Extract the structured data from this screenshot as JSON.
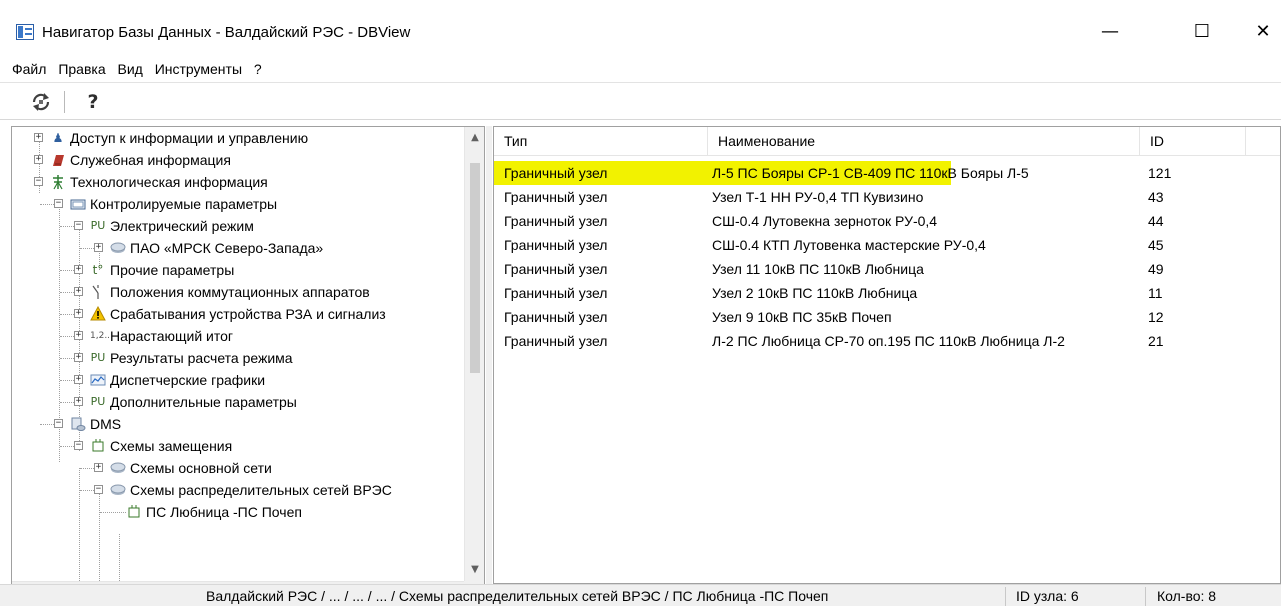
{
  "window": {
    "title": "Навигатор Базы Данных - Валдайский РЭС - DBView",
    "minimize_glyph": "—",
    "maximize_glyph": "☐",
    "close_glyph": "✕"
  },
  "menu": [
    "Файл",
    "Правка",
    "Вид",
    "Инструменты",
    "?"
  ],
  "toolbar": {
    "refresh_icon": "refresh-icon",
    "help_glyph": "?"
  },
  "tree": {
    "nodes": [
      {
        "label": "Доступ к информации и управлению",
        "icon": "user-icon",
        "level": 0,
        "expanded": false
      },
      {
        "label": "Служебная информация",
        "icon": "book-icon",
        "level": 0,
        "expanded": false
      },
      {
        "label": "Технологическая информация",
        "icon": "tower-icon",
        "level": 0,
        "expanded": true
      },
      {
        "label": "Контролируемые параметры",
        "icon": "meter-icon",
        "level": 1,
        "expanded": true
      },
      {
        "label": "Электрический режим",
        "icon": "pu-icon",
        "level": 2,
        "expanded": true
      },
      {
        "label": "ПАО «МРСК Северо-Запада»",
        "icon": "database-icon",
        "level": 3,
        "expanded": false
      },
      {
        "label": "Прочие параметры",
        "icon": "temperature-icon",
        "level": 2,
        "expanded": false
      },
      {
        "label": "Положения  коммутационных аппаратов",
        "icon": "switch-icon",
        "level": 2,
        "expanded": false
      },
      {
        "label": "Срабатывания устройства РЗА и сигнализ",
        "icon": "warning-icon",
        "level": 2,
        "expanded": false
      },
      {
        "label": "Нарастающий итог",
        "icon": "sequence-icon",
        "level": 2,
        "expanded": false
      },
      {
        "label": "Результаты расчета режима",
        "icon": "pu-icon",
        "level": 2,
        "expanded": false
      },
      {
        "label": "Диспетчерские графики",
        "icon": "chart-icon",
        "level": 2,
        "expanded": false
      },
      {
        "label": "Дополнительные параметры",
        "icon": "pu-icon",
        "level": 2,
        "expanded": false
      },
      {
        "label": "DMS",
        "icon": "dms-icon",
        "level": 1,
        "expanded": true
      },
      {
        "label": "Схемы замещения",
        "icon": "scheme-icon",
        "level": 2,
        "expanded": true
      },
      {
        "label": "Схемы основной сети",
        "icon": "database-icon",
        "level": 3,
        "expanded": false
      },
      {
        "label": "Схемы распределительных сетей ВРЭС",
        "icon": "database-icon",
        "level": 3,
        "expanded": true
      },
      {
        "label": "ПС Любница -ПС Почеп",
        "icon": "scheme-icon",
        "level": 4,
        "expanded": null
      }
    ]
  },
  "list": {
    "columns": [
      "Тип",
      "Наименование",
      "ID"
    ],
    "rows": [
      {
        "type": "Граничный узел",
        "name": "Л-5 ПС Бояры СР-1 СВ-409 ПС 110кВ Бояры Л-5",
        "id": "121",
        "selected": true
      },
      {
        "type": "Граничный узел",
        "name": "Узел Т-1 НН РУ-0,4 ТП Кувизино",
        "id": "43",
        "selected": false
      },
      {
        "type": "Граничный узел",
        "name": "СШ-0.4 Лутовекна зерноток РУ-0,4",
        "id": "44",
        "selected": false
      },
      {
        "type": "Граничный узел",
        "name": "СШ-0.4 КТП Лутовенка мастерские РУ-0,4",
        "id": "45",
        "selected": false
      },
      {
        "type": "Граничный узел",
        "name": "Узел 11 10кВ ПС 110кВ Любница",
        "id": "49",
        "selected": false
      },
      {
        "type": "Граничный узел",
        "name": "Узел 2 10кВ ПС 110кВ Любница",
        "id": "11",
        "selected": false
      },
      {
        "type": "Граничный узел",
        "name": "Узел 9 10кВ ПС 35кВ Почеп",
        "id": "12",
        "selected": false
      },
      {
        "type": "Граничный узел",
        "name": "Л-2 ПС Любница СР-70 оп.195 ПС 110кВ Любница Л-2",
        "id": "21",
        "selected": false
      }
    ],
    "selected_color": "#f2f200"
  },
  "status": {
    "path": "Валдайский РЭС / ... / ... / ... / Схемы распределительных сетей ВРЭС / ПС Любница -ПС Почеп",
    "node_id": "ID узла: 6",
    "count": "Кол-во: 8"
  }
}
